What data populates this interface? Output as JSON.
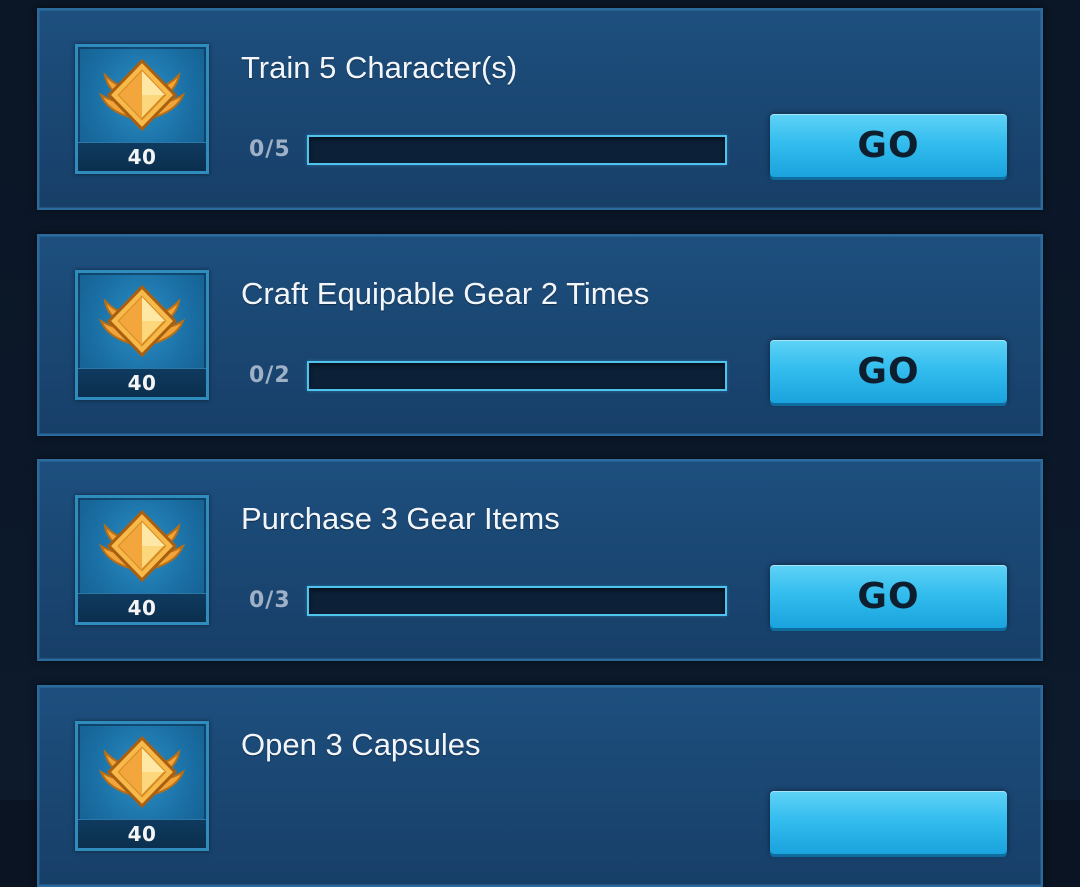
{
  "colors": {
    "card_background": "#1a4672",
    "card_border": "#2a6a9c",
    "progress_border": "#4ec3ee",
    "button": "#34bdee",
    "reward_badge": "gold-wings-emblem"
  },
  "tasks": [
    {
      "title": "Train 5 Character(s)",
      "reward": "40",
      "progress_label": "0/5",
      "progress_fraction": 0,
      "button_label": "GO"
    },
    {
      "title": "Craft Equipable Gear 2 Times",
      "reward": "40",
      "progress_label": "0/2",
      "progress_fraction": 0,
      "button_label": "GO"
    },
    {
      "title": "Purchase 3 Gear Items",
      "reward": "40",
      "progress_label": "0/3",
      "progress_fraction": 0,
      "button_label": "GO"
    },
    {
      "title": "Open 3 Capsules",
      "reward": "40",
      "progress_label": "",
      "progress_fraction": 0,
      "button_label": ""
    }
  ]
}
